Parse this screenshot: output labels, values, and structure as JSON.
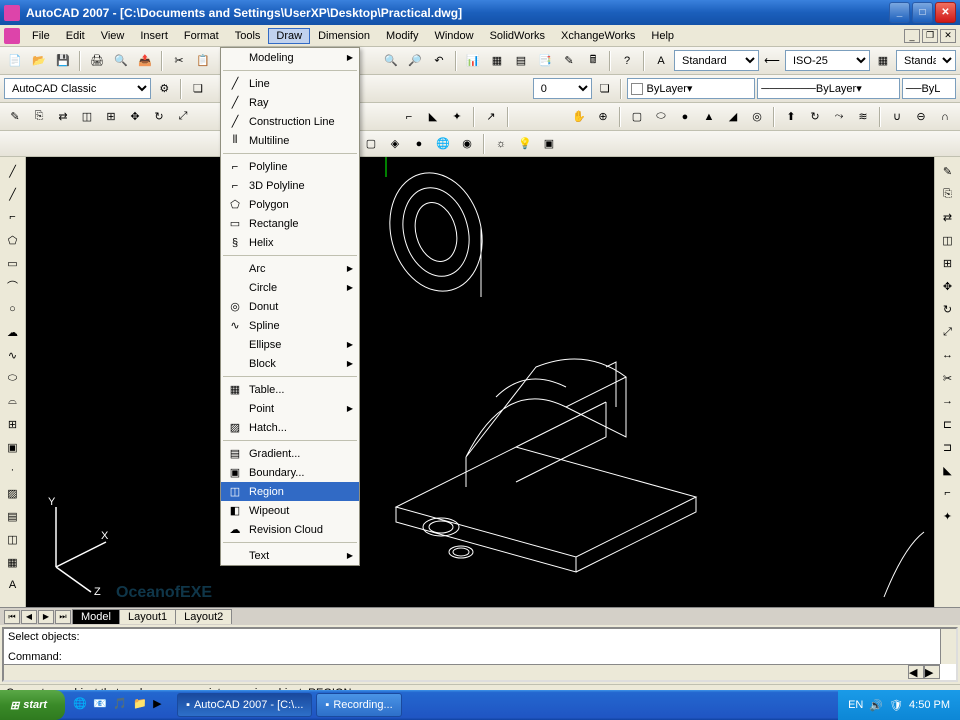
{
  "title": "AutoCAD 2007 - [C:\\Documents and Settings\\UserXP\\Desktop\\Practical.dwg]",
  "menubar": [
    "File",
    "Edit",
    "View",
    "Insert",
    "Format",
    "Tools",
    "Draw",
    "Dimension",
    "Modify",
    "Window",
    "SolidWorks",
    "XchangeWorks",
    "Help"
  ],
  "active_menu_index": 6,
  "workspace_combo": "AutoCAD Classic",
  "style_combo": "Standard",
  "dim_combo": "ISO-25",
  "table_combo": "Standard",
  "layer_combo": "0",
  "color_combo": "ByLayer",
  "linetype_combo": "ByLayer",
  "lineweight_combo": "ByL",
  "draw_menu": {
    "sections": [
      [
        {
          "label": "Modeling",
          "sub": true
        }
      ],
      [
        {
          "label": "Line",
          "icon": "╱"
        },
        {
          "label": "Ray",
          "icon": "╱"
        },
        {
          "label": "Construction Line",
          "icon": "╱"
        },
        {
          "label": "Multiline",
          "icon": "⦀"
        }
      ],
      [
        {
          "label": "Polyline",
          "icon": "⌐"
        },
        {
          "label": "3D Polyline",
          "icon": "⌐"
        },
        {
          "label": "Polygon",
          "icon": "⬠"
        },
        {
          "label": "Rectangle",
          "icon": "▭"
        },
        {
          "label": "Helix",
          "icon": "§"
        }
      ],
      [
        {
          "label": "Arc",
          "sub": true
        },
        {
          "label": "Circle",
          "sub": true
        },
        {
          "label": "Donut",
          "icon": "◎"
        },
        {
          "label": "Spline",
          "icon": "∿"
        },
        {
          "label": "Ellipse",
          "sub": true
        },
        {
          "label": "Block",
          "sub": true
        }
      ],
      [
        {
          "label": "Table...",
          "icon": "▦"
        },
        {
          "label": "Point",
          "sub": true
        },
        {
          "label": "Hatch...",
          "icon": "▨"
        }
      ],
      [
        {
          "label": "Gradient...",
          "icon": "▤"
        },
        {
          "label": "Boundary...",
          "icon": "▣"
        },
        {
          "label": "Region",
          "icon": "◫",
          "highlight": true
        },
        {
          "label": "Wipeout",
          "icon": "◧"
        },
        {
          "label": "Revision Cloud",
          "icon": "☁"
        }
      ],
      [
        {
          "label": "Text",
          "sub": true
        }
      ]
    ]
  },
  "tabs": {
    "items": [
      "Model",
      "Layout1",
      "Layout2"
    ],
    "active": 0
  },
  "command": {
    "line1": "Select objects:",
    "line2": "Command:"
  },
  "status": "Converts an object that encloses an area into a region object:  REGION",
  "watermark": "OceanofEXE",
  "ucs": {
    "x": "X",
    "y": "Y",
    "z": "Z"
  },
  "taskbar": {
    "start": "start",
    "tasks": [
      {
        "label": "AutoCAD 2007 - [C:\\...",
        "active": true
      },
      {
        "label": "Recording..."
      }
    ],
    "tray": {
      "lang": "EN",
      "time": "4:50 PM"
    }
  }
}
